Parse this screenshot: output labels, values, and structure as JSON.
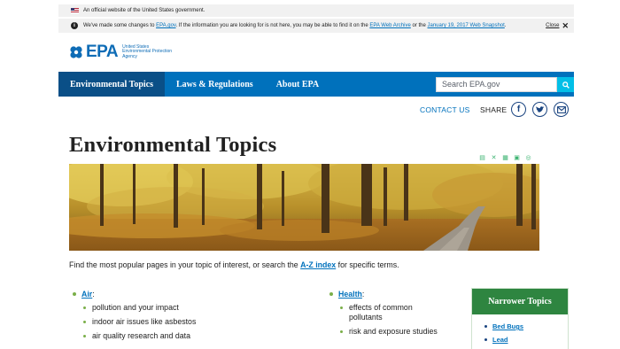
{
  "gov_banner": {
    "text": "An official website of the United States government."
  },
  "notice": {
    "pre": "We've made some changes to ",
    "link1": "EPA.gov",
    "mid": ". If the information you are looking for is not here, you may be able to find it on the ",
    "link2": "EPA Web Archive",
    "or": " or the ",
    "link3": "January 19, 2017 Web Snapshot",
    "end": ".",
    "close_label": "Close"
  },
  "logo": {
    "text": "EPA",
    "subtitle_1": "United States",
    "subtitle_2": "Environmental Protection",
    "subtitle_3": "Agency"
  },
  "nav": {
    "items": [
      {
        "label": "Environmental Topics"
      },
      {
        "label": "Laws & Regulations"
      },
      {
        "label": "About EPA"
      }
    ],
    "search_placeholder": "Search EPA.gov"
  },
  "utility": {
    "contact": "CONTACT US",
    "share": "SHARE"
  },
  "page_title": "Environmental Topics",
  "intro": {
    "pre": "Find the most popular pages in your topic of interest, or search the ",
    "link": "A-Z index",
    "post": " for specific terms."
  },
  "topics": [
    {
      "name": "Air",
      "items": [
        "pollution and your impact",
        "indoor air issues like asbestos",
        "air quality research and data"
      ]
    },
    {
      "name": "Health",
      "items": [
        "effects of common",
        "pollutants",
        "risk and exposure studies"
      ]
    }
  ],
  "narrower": {
    "title": "Narrower Topics",
    "items": [
      "Bed Bugs",
      "Lead"
    ]
  },
  "colors": {
    "nav_blue": "#0071bc",
    "nav_active": "#0a4f87",
    "green": "#2e8540",
    "search_button": "#02bfe7"
  }
}
